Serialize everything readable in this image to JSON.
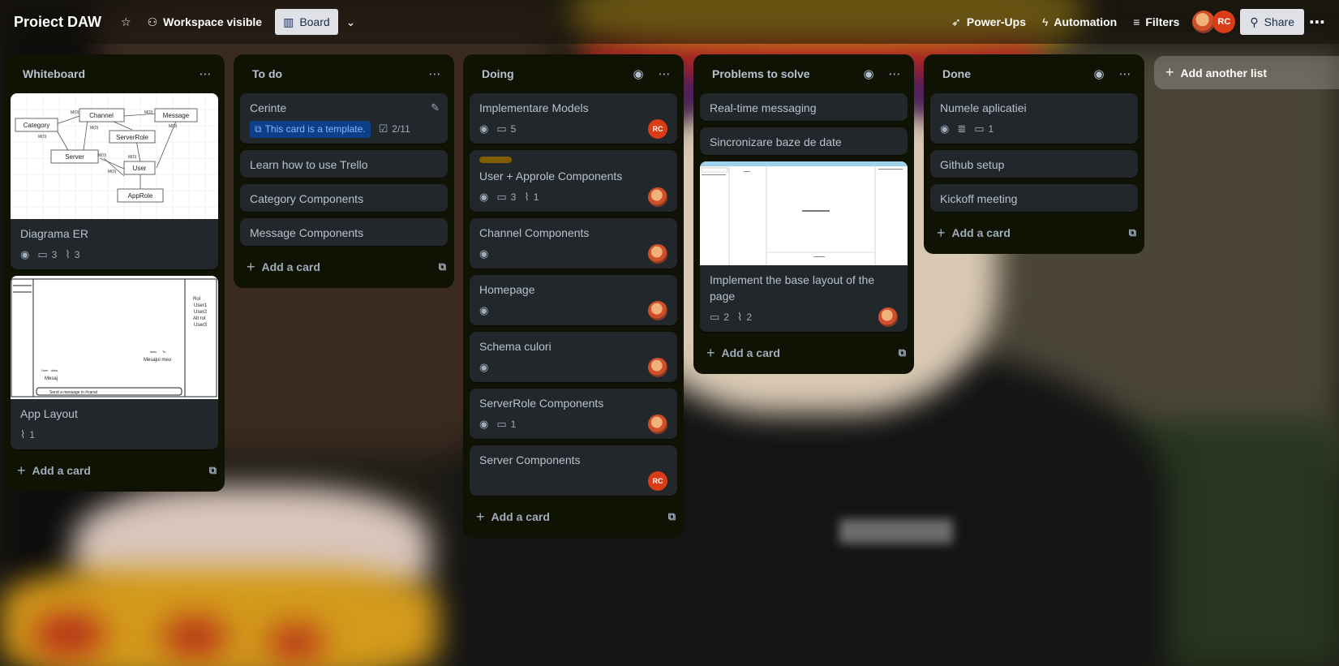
{
  "header": {
    "board_title": "Proiect DAW",
    "workspace_label": "Workspace visible",
    "board_view_label": "Board",
    "powerups_label": "Power-Ups",
    "automation_label": "Automation",
    "filters_label": "Filters",
    "member_initials": "RC",
    "share_label": "Share"
  },
  "lists": [
    {
      "title": "Whiteboard",
      "add_card_label": "Add a card",
      "cards": [
        {
          "title": "Diagrama ER",
          "badges": {
            "comments": "3",
            "attachments": "3"
          },
          "cover_labels": {
            "category": "Category",
            "channel": "Channel",
            "message": "Message",
            "serverrole": "ServerRole",
            "server": "Server",
            "user": "User",
            "approle": "AppRole",
            "m": "M(0)"
          }
        },
        {
          "title": "App Layout",
          "badges": {
            "attachments": "1"
          },
          "cover_labels": {
            "rol": "Rol",
            "user1": "User1",
            "user2": "User2",
            "alt_rol": "Alt rol",
            "user3": "User3",
            "data": "data",
            "tu": "Tu",
            "mesajul_meu": "Mesajul meu",
            "user": "User",
            "mesaj": "Mesaj",
            "send": "Send a message in #canal"
          }
        }
      ]
    },
    {
      "title": "To do",
      "add_card_label": "Add a card",
      "cards": [
        {
          "title": "Cerinte",
          "template_label": "This card is a template.",
          "checklist": "2/11"
        },
        {
          "title": "Learn how to use Trello"
        },
        {
          "title": "Category Components"
        },
        {
          "title": "Message Components"
        }
      ]
    },
    {
      "title": "Doing",
      "add_card_label": "Add a card",
      "cards": [
        {
          "title": "Implementare Models",
          "badges": {
            "comments": "5"
          },
          "member": "RC"
        },
        {
          "title": "User + Approle Components",
          "badges": {
            "comments": "3",
            "attachments": "1"
          }
        },
        {
          "title": "Channel Components"
        },
        {
          "title": "Homepage"
        },
        {
          "title": "Schema culori"
        },
        {
          "title": "ServerRole Components",
          "badges": {
            "comments": "1"
          }
        },
        {
          "title": "Server Components",
          "member": "RC"
        }
      ]
    },
    {
      "title": "Problems to solve",
      "add_card_label": "Add a card",
      "cards": [
        {
          "title": "Real-time messaging"
        },
        {
          "title": "Sincronizare baze de date"
        },
        {
          "title": "Implement the base layout of the page",
          "badges": {
            "comments": "2",
            "attachments": "2"
          }
        }
      ]
    },
    {
      "title": "Done",
      "add_card_label": "Add a card",
      "cards": [
        {
          "title": "Numele aplicatiei",
          "badges": {
            "comments": "1"
          }
        },
        {
          "title": "Github setup"
        },
        {
          "title": "Kickoff meeting"
        }
      ]
    }
  ],
  "add_list_label": "Add another list",
  "icons": {
    "star": "star-icon",
    "workspace": "people-icon",
    "board": "board-icon",
    "chevron": "chevron-down-icon",
    "powerups": "rocket-icon",
    "automation": "bolt-icon",
    "filters": "filter-icon",
    "share": "person-add-icon",
    "more": "ellipsis-icon",
    "watch": "eye-icon",
    "comment": "comment-icon",
    "attachment": "paperclip-icon",
    "description": "description-icon",
    "checklist": "checklist-icon",
    "template": "template-icon",
    "edit": "pencil-icon"
  },
  "colors": {
    "list_bg": "#101204",
    "card_bg": "#22272b",
    "member_rc": "#d93c16",
    "template_bg": "#0c3f86",
    "label": "#7f5f01"
  }
}
